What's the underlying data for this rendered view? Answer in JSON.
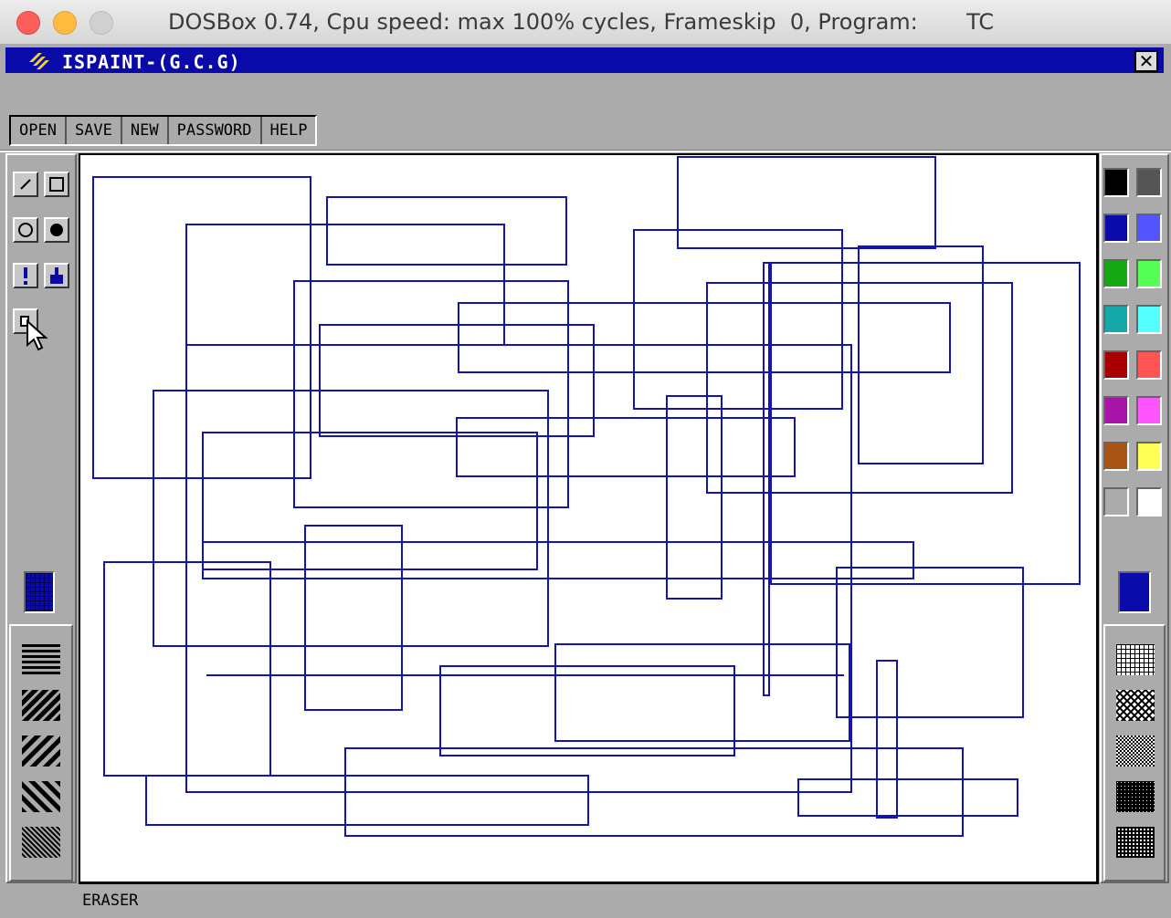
{
  "window": {
    "title": "DOSBox 0.74, Cpu speed: max 100% cycles, Frameskip  0, Program:       TC"
  },
  "app": {
    "title": "ISPAINT-(G.C.G)",
    "close_label": "✕"
  },
  "menu": [
    {
      "label": "OPEN"
    },
    {
      "label": "SAVE"
    },
    {
      "label": "NEW"
    },
    {
      "label": "PASSWORD"
    },
    {
      "label": "HELP"
    }
  ],
  "tools": [
    "line-tool",
    "rectangle-tool",
    "circle-tool",
    "filled-circle-tool",
    "spray-tool",
    "fill-bucket-tool",
    "eraser-tool"
  ],
  "palette": [
    "#000000",
    "#555555",
    "#0a0aa8",
    "#5555ff",
    "#14a814",
    "#55ff55",
    "#14a8a8",
    "#55ffff",
    "#a80000",
    "#ff5555",
    "#a814a8",
    "#ff55ff",
    "#a85414",
    "#ffff55",
    "#ababab",
    "#ffffff"
  ],
  "current_color": "#0a0aa8",
  "status": {
    "text": "ERASER"
  },
  "drawing": {
    "stroke": "#1414b4"
  }
}
